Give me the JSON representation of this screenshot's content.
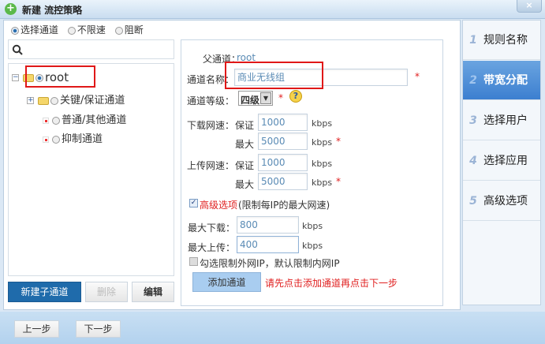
{
  "window": {
    "title": "新建 流控策略",
    "close": "×"
  },
  "modes": [
    {
      "label": "选择通道",
      "selected": true
    },
    {
      "label": "不限速",
      "selected": false
    },
    {
      "label": "阻断",
      "selected": false
    }
  ],
  "search": {
    "placeholder": ""
  },
  "tree": {
    "root": "root",
    "children": [
      "关键/保证通道",
      "普通/其他通道",
      "抑制通道"
    ]
  },
  "tree_buttons": {
    "new": "新建子通道",
    "delete": "删除",
    "edit": "编辑"
  },
  "form": {
    "parent_label": "父通道：",
    "parent_value": "root",
    "name_label": "通道名称：",
    "name_value": "商业无线组",
    "level_label": "通道等级：",
    "level_value": "四级",
    "download_label": "下载网速：",
    "upload_label": "上传网速：",
    "guarantee_label": "保证",
    "max_label": "最大",
    "unit": "kbps",
    "download_guarantee": "1000",
    "download_max": "5000",
    "upload_guarantee": "1000",
    "upload_max": "5000",
    "advanced_label": "高级选项",
    "advanced_note": "(限制每IP的最大网速)",
    "advanced_checked": true,
    "max_down_label": "最大下载：",
    "max_down_value": "800",
    "max_up_label": "最大上传：",
    "max_up_value": "400",
    "external_ip_label": "勾选限制外网IP，默认限制内网IP",
    "external_ip_checked": false,
    "add_button": "添加通道",
    "hint": "请先点击添加通道再点击下一步",
    "required": "*",
    "help": "?"
  },
  "steps": [
    {
      "num": "1",
      "label": "规则名称"
    },
    {
      "num": "2",
      "label": "带宽分配",
      "active": true
    },
    {
      "num": "3",
      "label": "选择用户"
    },
    {
      "num": "4",
      "label": "选择应用"
    },
    {
      "num": "5",
      "label": "高级选项"
    }
  ],
  "footer": {
    "prev": "上一步",
    "next": "下一步"
  }
}
